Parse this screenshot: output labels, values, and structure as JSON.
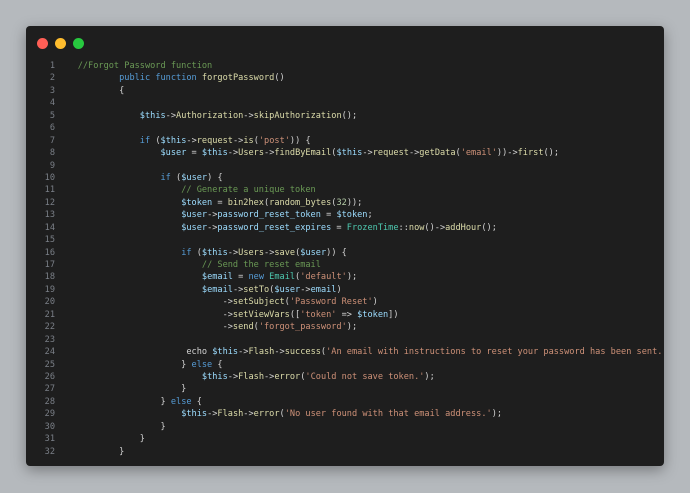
{
  "window": {
    "traffic_lights": [
      {
        "name": "close",
        "color": "#ff5f56"
      },
      {
        "name": "minimize",
        "color": "#ffbd2e"
      },
      {
        "name": "maximize",
        "color": "#27c93f"
      }
    ]
  },
  "editor": {
    "lines": [
      {
        "n": "1",
        "tokens": [
          [
            "comment",
            "//Forgot Password function"
          ]
        ]
      },
      {
        "n": "2",
        "tokens": [
          [
            "plain",
            "        "
          ],
          [
            "keyword",
            "public function "
          ],
          [
            "func",
            "forgotPassword"
          ],
          [
            "plain",
            "()"
          ]
        ]
      },
      {
        "n": "3",
        "tokens": [
          [
            "plain",
            "        {"
          ]
        ]
      },
      {
        "n": "4",
        "tokens": []
      },
      {
        "n": "5",
        "tokens": [
          [
            "plain",
            "            "
          ],
          [
            "var",
            "$this"
          ],
          [
            "plain",
            "->"
          ],
          [
            "func",
            "Authorization"
          ],
          [
            "plain",
            "->"
          ],
          [
            "func",
            "skipAuthorization"
          ],
          [
            "plain",
            "();"
          ]
        ]
      },
      {
        "n": "6",
        "tokens": []
      },
      {
        "n": "7",
        "tokens": [
          [
            "plain",
            "            "
          ],
          [
            "keyword",
            "if"
          ],
          [
            "plain",
            " ("
          ],
          [
            "var",
            "$this"
          ],
          [
            "plain",
            "->"
          ],
          [
            "func",
            "request"
          ],
          [
            "plain",
            "->"
          ],
          [
            "func",
            "is"
          ],
          [
            "plain",
            "("
          ],
          [
            "string",
            "'post'"
          ],
          [
            "plain",
            ")) {"
          ]
        ]
      },
      {
        "n": "8",
        "tokens": [
          [
            "plain",
            "                "
          ],
          [
            "var",
            "$user"
          ],
          [
            "plain",
            " = "
          ],
          [
            "var",
            "$this"
          ],
          [
            "plain",
            "->"
          ],
          [
            "func",
            "Users"
          ],
          [
            "plain",
            "->"
          ],
          [
            "func",
            "findByEmail"
          ],
          [
            "plain",
            "("
          ],
          [
            "var",
            "$this"
          ],
          [
            "plain",
            "->"
          ],
          [
            "func",
            "request"
          ],
          [
            "plain",
            "->"
          ],
          [
            "func",
            "getData"
          ],
          [
            "plain",
            "("
          ],
          [
            "string",
            "'email'"
          ],
          [
            "plain",
            "))->"
          ],
          [
            "func",
            "first"
          ],
          [
            "plain",
            "();"
          ]
        ]
      },
      {
        "n": "9",
        "tokens": []
      },
      {
        "n": "10",
        "tokens": [
          [
            "plain",
            "                "
          ],
          [
            "keyword",
            "if"
          ],
          [
            "plain",
            " ("
          ],
          [
            "var",
            "$user"
          ],
          [
            "plain",
            ") {"
          ]
        ]
      },
      {
        "n": "11",
        "tokens": [
          [
            "plain",
            "                    "
          ],
          [
            "comment",
            "// Generate a unique token"
          ]
        ]
      },
      {
        "n": "12",
        "tokens": [
          [
            "plain",
            "                    "
          ],
          [
            "var",
            "$token"
          ],
          [
            "plain",
            " = "
          ],
          [
            "func",
            "bin2hex"
          ],
          [
            "plain",
            "("
          ],
          [
            "func",
            "random_bytes"
          ],
          [
            "plain",
            "("
          ],
          [
            "number",
            "32"
          ],
          [
            "plain",
            "));"
          ]
        ]
      },
      {
        "n": "13",
        "tokens": [
          [
            "plain",
            "                    "
          ],
          [
            "var",
            "$user"
          ],
          [
            "plain",
            "->"
          ],
          [
            "var",
            "password_reset_token"
          ],
          [
            "plain",
            " = "
          ],
          [
            "var",
            "$token"
          ],
          [
            "plain",
            ";"
          ]
        ]
      },
      {
        "n": "14",
        "tokens": [
          [
            "plain",
            "                    "
          ],
          [
            "var",
            "$user"
          ],
          [
            "plain",
            "->"
          ],
          [
            "var",
            "password_reset_expires"
          ],
          [
            "plain",
            " = "
          ],
          [
            "class",
            "FrozenTime"
          ],
          [
            "plain",
            "::"
          ],
          [
            "func",
            "now"
          ],
          [
            "plain",
            "()->"
          ],
          [
            "func",
            "addHour"
          ],
          [
            "plain",
            "();"
          ]
        ]
      },
      {
        "n": "15",
        "tokens": []
      },
      {
        "n": "16",
        "tokens": [
          [
            "plain",
            "                    "
          ],
          [
            "keyword",
            "if"
          ],
          [
            "plain",
            " ("
          ],
          [
            "var",
            "$this"
          ],
          [
            "plain",
            "->"
          ],
          [
            "func",
            "Users"
          ],
          [
            "plain",
            "->"
          ],
          [
            "func",
            "save"
          ],
          [
            "plain",
            "("
          ],
          [
            "var",
            "$user"
          ],
          [
            "plain",
            ")) {"
          ]
        ]
      },
      {
        "n": "17",
        "tokens": [
          [
            "plain",
            "                        "
          ],
          [
            "comment",
            "// Send the reset email"
          ]
        ]
      },
      {
        "n": "18",
        "tokens": [
          [
            "plain",
            "                        "
          ],
          [
            "var",
            "$email"
          ],
          [
            "plain",
            " = "
          ],
          [
            "keyword",
            "new "
          ],
          [
            "class",
            "Email"
          ],
          [
            "plain",
            "("
          ],
          [
            "string",
            "'default'"
          ],
          [
            "plain",
            ");"
          ]
        ]
      },
      {
        "n": "19",
        "tokens": [
          [
            "plain",
            "                        "
          ],
          [
            "var",
            "$email"
          ],
          [
            "plain",
            "->"
          ],
          [
            "func",
            "setTo"
          ],
          [
            "plain",
            "("
          ],
          [
            "var",
            "$user"
          ],
          [
            "plain",
            "->"
          ],
          [
            "var",
            "email"
          ],
          [
            "plain",
            ")"
          ]
        ]
      },
      {
        "n": "20",
        "tokens": [
          [
            "plain",
            "                            ->"
          ],
          [
            "func",
            "setSubject"
          ],
          [
            "plain",
            "("
          ],
          [
            "string",
            "'Password Reset'"
          ],
          [
            "plain",
            ")"
          ]
        ]
      },
      {
        "n": "21",
        "tokens": [
          [
            "plain",
            "                            ->"
          ],
          [
            "func",
            "setViewVars"
          ],
          [
            "plain",
            "(["
          ],
          [
            "string",
            "'token'"
          ],
          [
            "plain",
            " => "
          ],
          [
            "var",
            "$token"
          ],
          [
            "plain",
            "])"
          ]
        ]
      },
      {
        "n": "22",
        "tokens": [
          [
            "plain",
            "                            ->"
          ],
          [
            "func",
            "send"
          ],
          [
            "plain",
            "("
          ],
          [
            "string",
            "'forgot_password'"
          ],
          [
            "plain",
            ");"
          ]
        ]
      },
      {
        "n": "23",
        "tokens": []
      },
      {
        "n": "24",
        "tokens": [
          [
            "plain",
            "                     echo "
          ],
          [
            "var",
            "$this"
          ],
          [
            "plain",
            "->"
          ],
          [
            "func",
            "Flash"
          ],
          [
            "plain",
            "->"
          ],
          [
            "func",
            "success"
          ],
          [
            "plain",
            "("
          ],
          [
            "string",
            "'An email with instructions to reset your password has been sent.'"
          ],
          [
            "plain",
            ");"
          ]
        ]
      },
      {
        "n": "25",
        "tokens": [
          [
            "plain",
            "                    } "
          ],
          [
            "keyword",
            "else"
          ],
          [
            "plain",
            " {"
          ]
        ]
      },
      {
        "n": "26",
        "tokens": [
          [
            "plain",
            "                        "
          ],
          [
            "var",
            "$this"
          ],
          [
            "plain",
            "->"
          ],
          [
            "func",
            "Flash"
          ],
          [
            "plain",
            "->"
          ],
          [
            "func",
            "error"
          ],
          [
            "plain",
            "("
          ],
          [
            "string",
            "'Could not save token.'"
          ],
          [
            "plain",
            ");"
          ]
        ]
      },
      {
        "n": "27",
        "tokens": [
          [
            "plain",
            "                    }"
          ]
        ]
      },
      {
        "n": "28",
        "tokens": [
          [
            "plain",
            "                } "
          ],
          [
            "keyword",
            "else"
          ],
          [
            "plain",
            " {"
          ]
        ]
      },
      {
        "n": "29",
        "tokens": [
          [
            "plain",
            "                    "
          ],
          [
            "var",
            "$this"
          ],
          [
            "plain",
            "->"
          ],
          [
            "func",
            "Flash"
          ],
          [
            "plain",
            "->"
          ],
          [
            "func",
            "error"
          ],
          [
            "plain",
            "("
          ],
          [
            "string",
            "'No user found with that email address.'"
          ],
          [
            "plain",
            ");"
          ]
        ]
      },
      {
        "n": "30",
        "tokens": [
          [
            "plain",
            "                }"
          ]
        ]
      },
      {
        "n": "31",
        "tokens": [
          [
            "plain",
            "            }"
          ]
        ]
      },
      {
        "n": "32",
        "tokens": [
          [
            "plain",
            "        }"
          ]
        ]
      }
    ]
  }
}
